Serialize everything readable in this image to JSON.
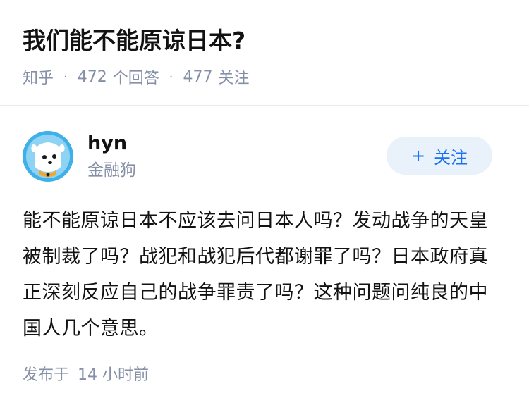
{
  "question": {
    "title": "我们能不能原谅日本?",
    "source": "知乎",
    "answer_count": "472",
    "answer_label": "个回答",
    "follower_count": "477",
    "follower_label": "关注",
    "separator": "·"
  },
  "answer": {
    "author": {
      "name": "hyn",
      "headline": "金融狗",
      "avatar_icon": "dog-mascot-avatar"
    },
    "follow_button": {
      "plus": "+",
      "label": "关注"
    },
    "content": "能不能原谅日本不应该去问日本人吗？发动战争的天皇被制裁了吗？战犯和战犯后代都谢罪了吗？日本政府真正深刻反应自己的战争罪责了吗？这种问题问纯良的中国人几个意思。",
    "published_label": "发布于",
    "published_time": "14 小时前"
  },
  "colors": {
    "accent": "#1772f6",
    "muted": "#8590a6",
    "follow_bg": "#e9f1fb",
    "avatar_bg": "#3fb0e8"
  }
}
